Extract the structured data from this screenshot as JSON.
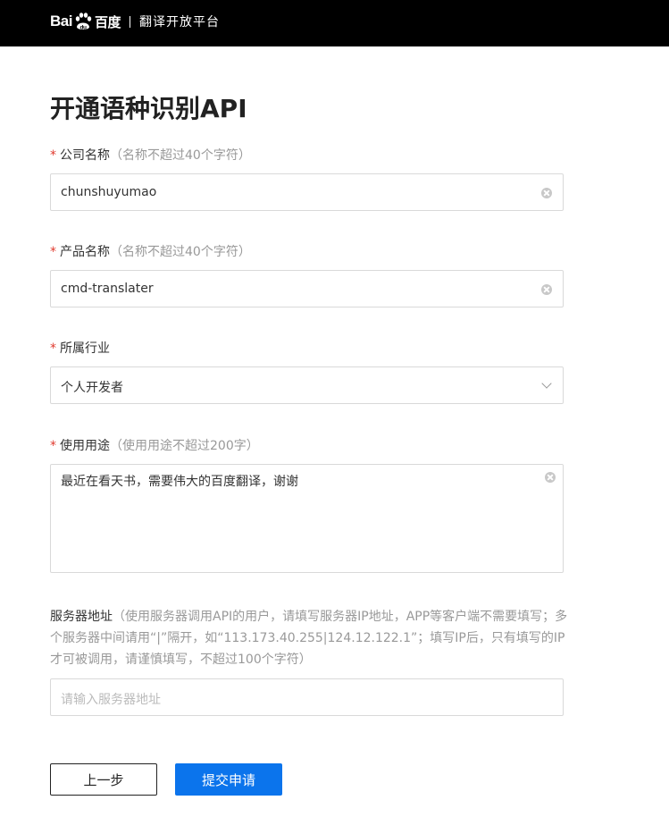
{
  "header": {
    "logo_prefix": "Bai",
    "logo_suffix": "百度",
    "logo_du_glyph": "du",
    "product_title": "翻译开放平台"
  },
  "page": {
    "title": "开通语种识别API"
  },
  "form": {
    "required_mark": "*",
    "company": {
      "label": "公司名称",
      "hint": "（名称不超过40个字符）",
      "value": "chunshuyumao"
    },
    "product": {
      "label": "产品名称",
      "hint": "（名称不超过40个字符）",
      "value": "cmd-translater"
    },
    "industry": {
      "label": "所属行业",
      "value": "个人开发者"
    },
    "usage": {
      "label": "使用用途",
      "hint": "（使用用途不超过200字）",
      "value": "最近在看天书，需要伟大的百度翻译，谢谢"
    },
    "server": {
      "label": "服务器地址",
      "hint": "（使用服务器调用API的用户，请填写服务器IP地址，APP等客户端不需要填写；多个服务器中间请用“|”隔开，如“113.173.40.255|124.12.122.1”；填写IP后，只有填写的IP才可被调用，请谨慎填写，不超过100个字符）",
      "placeholder": "请输入服务器地址"
    }
  },
  "buttons": {
    "prev": "上一步",
    "submit": "提交申请"
  },
  "colors": {
    "header_bg": "#000000",
    "required": "#e03a2e",
    "primary": "#0b74ec"
  }
}
